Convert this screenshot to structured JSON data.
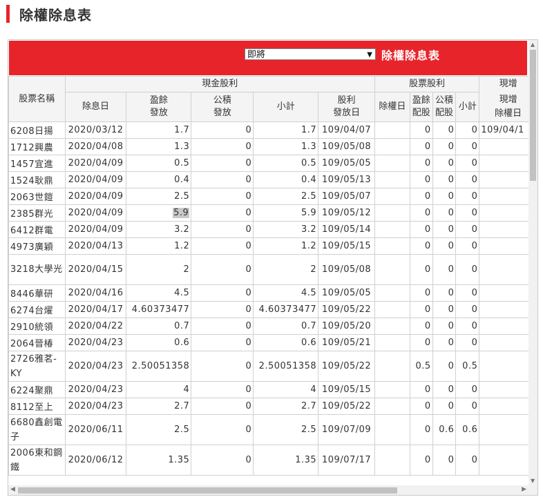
{
  "page": {
    "title": "除權除息表"
  },
  "panel": {
    "select_value": "即將",
    "header_title": "除權除息表"
  },
  "table": {
    "group_headers": {
      "name": "股票名稱",
      "cash": "現金股利",
      "stock": "股票股利",
      "current": "現增"
    },
    "sub_headers": {
      "ex_div_date": "除息日",
      "earnings_dist": "盈餘\n發放",
      "reserve_dist": "公積\n發放",
      "cash_subtotal": "小計",
      "pay_date": "股利\n發放日",
      "ex_right_date": "除權日",
      "earnings_alloc": "盈餘\n配股",
      "reserve_alloc": "公積\n配股",
      "stock_subtotal": "小計",
      "current_date": "現增\n除權日"
    },
    "rows": [
      {
        "name": "6208日揚",
        "ex_div": "2020/03/12",
        "earn": "1.7",
        "reserve": "0",
        "cash_sub": "1.7",
        "pay": "109/04/07",
        "ex_right": "",
        "earn_alloc": "0",
        "res_alloc": "0",
        "stock_sub": "0",
        "current": "109/04/1"
      },
      {
        "name": "1712興農",
        "ex_div": "2020/04/08",
        "earn": "1.3",
        "reserve": "0",
        "cash_sub": "1.3",
        "pay": "109/05/08",
        "ex_right": "",
        "earn_alloc": "0",
        "res_alloc": "0",
        "stock_sub": "0",
        "current": ""
      },
      {
        "name": "1457宜進",
        "ex_div": "2020/04/09",
        "earn": "0.5",
        "reserve": "0",
        "cash_sub": "0.5",
        "pay": "109/05/05",
        "ex_right": "",
        "earn_alloc": "0",
        "res_alloc": "0",
        "stock_sub": "0",
        "current": ""
      },
      {
        "name": "1524耿鼎",
        "ex_div": "2020/04/09",
        "earn": "0.4",
        "reserve": "0",
        "cash_sub": "0.4",
        "pay": "109/05/13",
        "ex_right": "",
        "earn_alloc": "0",
        "res_alloc": "0",
        "stock_sub": "0",
        "current": ""
      },
      {
        "name": "2063世鎧",
        "ex_div": "2020/04/09",
        "earn": "2.5",
        "reserve": "0",
        "cash_sub": "2.5",
        "pay": "109/05/07",
        "ex_right": "",
        "earn_alloc": "0",
        "res_alloc": "0",
        "stock_sub": "0",
        "current": ""
      },
      {
        "name": "2385群光",
        "ex_div": "2020/04/09",
        "earn": "5.9",
        "reserve": "0",
        "cash_sub": "5.9",
        "pay": "109/05/12",
        "ex_right": "",
        "earn_alloc": "0",
        "res_alloc": "0",
        "stock_sub": "0",
        "current": "",
        "highlight": true
      },
      {
        "name": "6412群電",
        "ex_div": "2020/04/09",
        "earn": "3.2",
        "reserve": "0",
        "cash_sub": "3.2",
        "pay": "109/05/14",
        "ex_right": "",
        "earn_alloc": "0",
        "res_alloc": "0",
        "stock_sub": "0",
        "current": ""
      },
      {
        "name": "4973廣穎",
        "ex_div": "2020/04/13",
        "earn": "1.2",
        "reserve": "0",
        "cash_sub": "1.2",
        "pay": "109/05/15",
        "ex_right": "",
        "earn_alloc": "0",
        "res_alloc": "0",
        "stock_sub": "0",
        "current": ""
      },
      {
        "name": "3218大學光",
        "ex_div": "2020/04/15",
        "earn": "2",
        "reserve": "0",
        "cash_sub": "2",
        "pay": "109/05/08",
        "ex_right": "",
        "earn_alloc": "0",
        "res_alloc": "0",
        "stock_sub": "0",
        "current": "",
        "tall": true
      },
      {
        "name": "8446華研",
        "ex_div": "2020/04/16",
        "earn": "4.5",
        "reserve": "0",
        "cash_sub": "4.5",
        "pay": "109/05/05",
        "ex_right": "",
        "earn_alloc": "0",
        "res_alloc": "0",
        "stock_sub": "0",
        "current": ""
      },
      {
        "name": "6274台燿",
        "ex_div": "2020/04/17",
        "earn": "4.60373477",
        "reserve": "0",
        "cash_sub": "4.60373477",
        "pay": "109/05/22",
        "ex_right": "",
        "earn_alloc": "0",
        "res_alloc": "0",
        "stock_sub": "0",
        "current": ""
      },
      {
        "name": "2910統領",
        "ex_div": "2020/04/22",
        "earn": "0.7",
        "reserve": "0",
        "cash_sub": "0.7",
        "pay": "109/05/20",
        "ex_right": "",
        "earn_alloc": "0",
        "res_alloc": "0",
        "stock_sub": "0",
        "current": ""
      },
      {
        "name": "2064晉椿",
        "ex_div": "2020/04/23",
        "earn": "0.6",
        "reserve": "0",
        "cash_sub": "0.6",
        "pay": "109/05/21",
        "ex_right": "",
        "earn_alloc": "0",
        "res_alloc": "0",
        "stock_sub": "0",
        "current": ""
      },
      {
        "name": "2726雅茗-KY",
        "ex_div": "2020/04/23",
        "earn": "2.50051358",
        "reserve": "0",
        "cash_sub": "2.50051358",
        "pay": "109/05/22",
        "ex_right": "",
        "earn_alloc": "0.5",
        "res_alloc": "0",
        "stock_sub": "0.5",
        "current": "",
        "tall": true
      },
      {
        "name": "6224聚鼎",
        "ex_div": "2020/04/23",
        "earn": "4",
        "reserve": "0",
        "cash_sub": "4",
        "pay": "109/05/15",
        "ex_right": "",
        "earn_alloc": "0",
        "res_alloc": "0",
        "stock_sub": "0",
        "current": ""
      },
      {
        "name": "8112至上",
        "ex_div": "2020/04/23",
        "earn": "2.7",
        "reserve": "0",
        "cash_sub": "2.7",
        "pay": "109/05/22",
        "ex_right": "",
        "earn_alloc": "0",
        "res_alloc": "0",
        "stock_sub": "0",
        "current": ""
      },
      {
        "name": "6680鑫創電子",
        "ex_div": "2020/06/11",
        "earn": "2.5",
        "reserve": "0",
        "cash_sub": "2.5",
        "pay": "109/07/09",
        "ex_right": "",
        "earn_alloc": "0",
        "res_alloc": "0.6",
        "stock_sub": "0.6",
        "current": "",
        "tall": true
      },
      {
        "name": "2006東和鋼鐵",
        "ex_div": "2020/06/12",
        "earn": "1.35",
        "reserve": "0",
        "cash_sub": "1.35",
        "pay": "109/07/17",
        "ex_right": "",
        "earn_alloc": "0",
        "res_alloc": "0",
        "stock_sub": "0",
        "current": "",
        "tall": true
      }
    ]
  },
  "colors": {
    "accent": "#e8242b",
    "header_bg": "#f4f4f4",
    "border": "#d0d0d0"
  }
}
